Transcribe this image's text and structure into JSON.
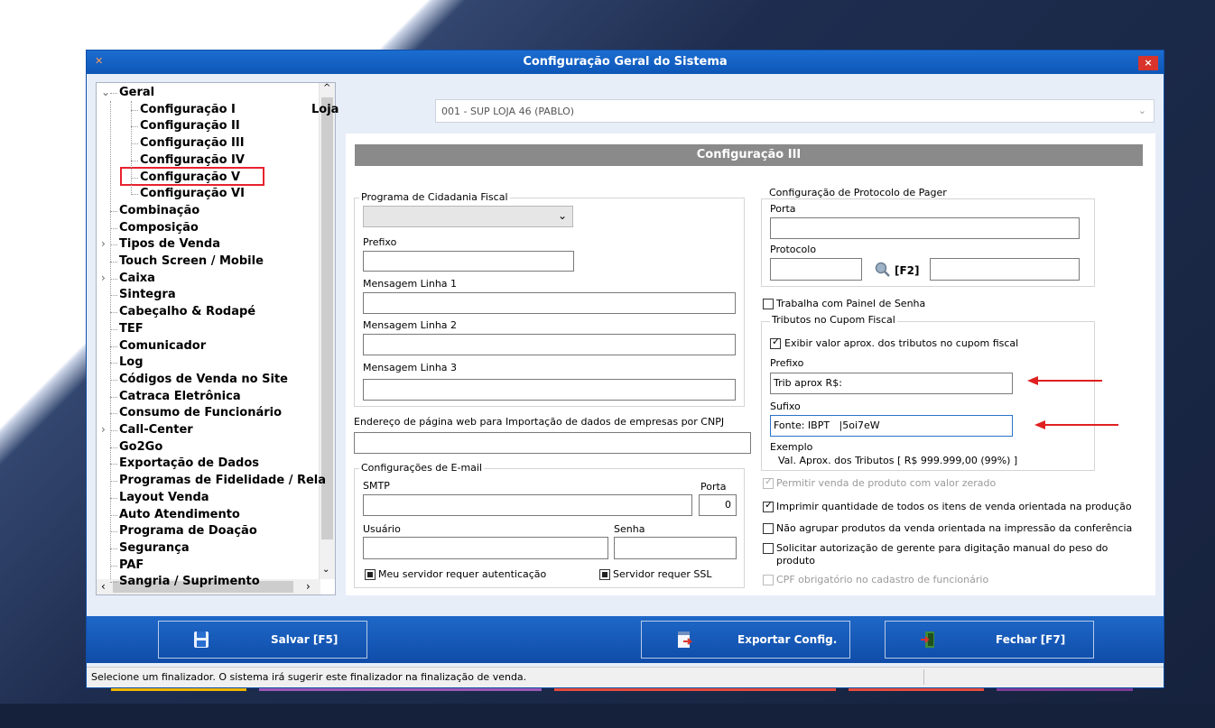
{
  "window": {
    "title": "Configuração Geral do Sistema",
    "close": "×"
  },
  "tree": {
    "items": [
      {
        "label": "Geral",
        "expander": "⌄"
      },
      {
        "label": "Configuração I"
      },
      {
        "label": "Configuração II"
      },
      {
        "label": "Configuração III"
      },
      {
        "label": "Configuração IV"
      },
      {
        "label": "Configuração V"
      },
      {
        "label": "Configuração VI"
      },
      {
        "label": "Combinação"
      },
      {
        "label": "Composição"
      },
      {
        "label": "Tipos de Venda",
        "expander": "›"
      },
      {
        "label": "Touch Screen / Mobile"
      },
      {
        "label": "Caixa",
        "expander": "›"
      },
      {
        "label": "Sintegra"
      },
      {
        "label": "Cabeçalho & Rodapé"
      },
      {
        "label": "TEF"
      },
      {
        "label": "Comunicador"
      },
      {
        "label": "Log"
      },
      {
        "label": "Códigos de Venda no Site"
      },
      {
        "label": "Catraca Eletrônica"
      },
      {
        "label": "Consumo de Funcionário"
      },
      {
        "label": "Call-Center",
        "expander": "›"
      },
      {
        "label": "Go2Go"
      },
      {
        "label": "Exportação de Dados"
      },
      {
        "label": "Programas de Fidelidade / Rela"
      },
      {
        "label": "Layout Venda"
      },
      {
        "label": "Auto Atendimento"
      },
      {
        "label": "Programa de Doação"
      },
      {
        "label": "Segurança"
      },
      {
        "label": "PAF"
      },
      {
        "label": "Sangria / Suprimento"
      }
    ],
    "scroll_up": "^",
    "scroll_down": "⌄",
    "scroll_left": "‹",
    "scroll_right": "›"
  },
  "loja": {
    "label": "Loja",
    "value": "001 - SUP LOJA 46 (PABLO)",
    "chevron": "⌄"
  },
  "section_title": "Configuração III",
  "cidadania": {
    "title": "Programa de Cidadania Fiscal",
    "select_value": "",
    "chevron": "⌄",
    "prefixo_label": "Prefixo",
    "linha1_label": "Mensagem Linha 1",
    "linha2_label": "Mensagem Linha 2",
    "linha3_label": "Mensagem Linha 3"
  },
  "endereco": {
    "label": "Endereço de página web para Importação de dados de empresas por CNPJ",
    "value": ""
  },
  "email": {
    "title": "Configurações de E-mail",
    "smtp_label": "SMTP",
    "porta_label": "Porta",
    "porta_value": "0",
    "usuario_label": "Usuário",
    "senha_label": "Senha",
    "auth_label": "Meu servidor requer autenticação",
    "ssl_label": "Servidor requer SSL"
  },
  "pager": {
    "title": "Configuração de Protocolo de Pager",
    "porta_label": "Porta",
    "protocolo_label": "Protocolo",
    "f2_label": "[F2]"
  },
  "painel": {
    "label": "Trabalha com Painel de Senha",
    "checked": false
  },
  "tributos": {
    "title": "Tributos no Cupom Fiscal",
    "exibir_label": "Exibir valor aprox. dos tributos no cupom fiscal",
    "exibir_checked": true,
    "prefixo_label": "Prefixo",
    "prefixo_value": "Trib aprox R$:",
    "sufixo_label": "Sufixo",
    "sufixo_value": "Fonte: IBPT   |5oi7eW",
    "exemplo_label": "Exemplo",
    "exemplo_text": "Val. Aprox. dos Tributos [ R$ 999.999,00 (99%) ]"
  },
  "options": [
    {
      "label": "Permitir venda de produto com valor zerado",
      "checked": true,
      "disabled": true
    },
    {
      "label": "Imprimir quantidade de todos os itens de venda orientada na produção",
      "checked": true,
      "disabled": false
    },
    {
      "label": "Não agrupar produtos da venda orientada na impressão da conferência",
      "checked": false,
      "disabled": false
    },
    {
      "label": "Solicitar autorização de gerente para digitação manual do peso do",
      "label2": "produto",
      "checked": false,
      "disabled": false
    },
    {
      "label": "CPF obrigatório no cadastro de funcionário",
      "checked": false,
      "disabled": true
    }
  ],
  "buttons": {
    "save": "Salvar [F5]",
    "export": "Exportar Config.",
    "close": "Fechar [F7]"
  },
  "status": {
    "message": "Selecione um finalizador. O sistema irá sugerir este finalizador na finalização de venda."
  },
  "colors": {
    "titlebar": "#0d56b8",
    "highlight": "#e8222e",
    "annotation_arrow": "#e02020",
    "panel_header": "#8a8a8a"
  }
}
